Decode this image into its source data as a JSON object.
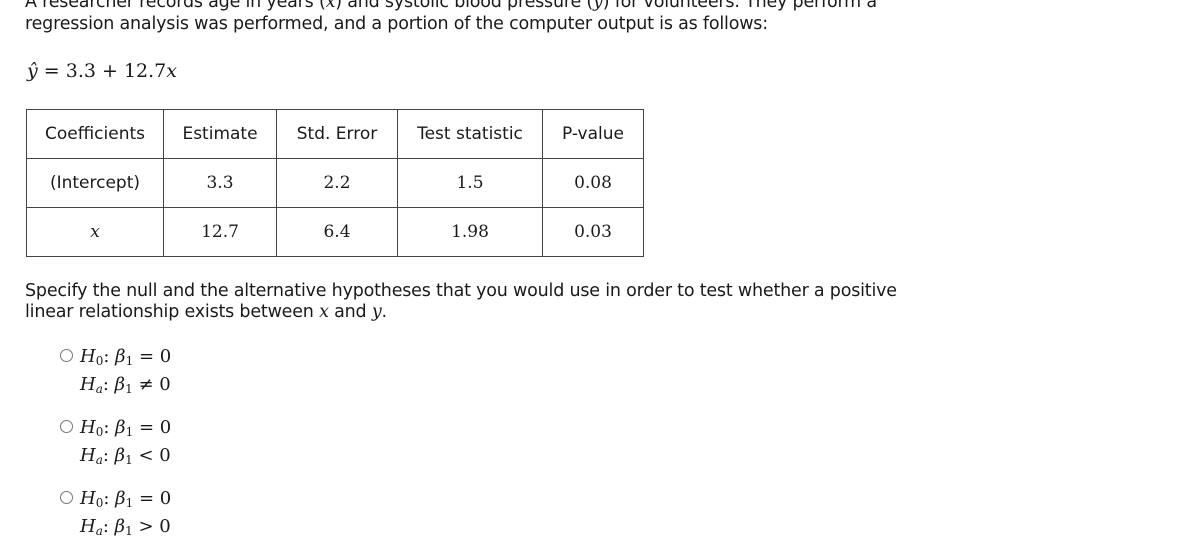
{
  "intro": {
    "part1": "A researcher records age in years (",
    "x": "x",
    "part2": ") and systolic blood pressure (",
    "y": "y",
    "part3": ") for volunteers. They perform a regression analysis was performed, and a portion of the computer output is as follows:"
  },
  "equation": {
    "lhs": "ŷ",
    "eq": " = ",
    "rhs_const": "3.3 + 12.7",
    "rhs_var": "x"
  },
  "table": {
    "headers": [
      "Coefficients",
      "Estimate",
      "Std. Error",
      "Test statistic",
      "P-value"
    ],
    "rows": [
      {
        "coef": "(Intercept)",
        "estimate": "3.3",
        "std_error": "2.2",
        "test_statistic": "1.5",
        "p_value": "0.08"
      },
      {
        "coef": "x",
        "estimate": "12.7",
        "std_error": "6.4",
        "test_statistic": "1.98",
        "p_value": "0.03"
      }
    ]
  },
  "question": {
    "part1": "Specify the null and the alternative hypotheses that you would use in order to test whether a positive linear relationship exists between ",
    "x": "x",
    "mid": " and ",
    "y": "y",
    "end": "."
  },
  "options": [
    {
      "h0_rel": "=",
      "h0_val": "0",
      "ha_rel": "≠",
      "ha_val": "0"
    },
    {
      "h0_rel": "=",
      "h0_val": "0",
      "ha_rel": "<",
      "ha_val": "0"
    },
    {
      "h0_rel": "=",
      "h0_val": "0",
      "ha_rel": ">",
      "ha_val": "0"
    }
  ],
  "symbols": {
    "H": "H",
    "null_sub": "0",
    "alt_sub": "a",
    "beta": "β",
    "beta_sub": "1",
    "colon": ":"
  }
}
